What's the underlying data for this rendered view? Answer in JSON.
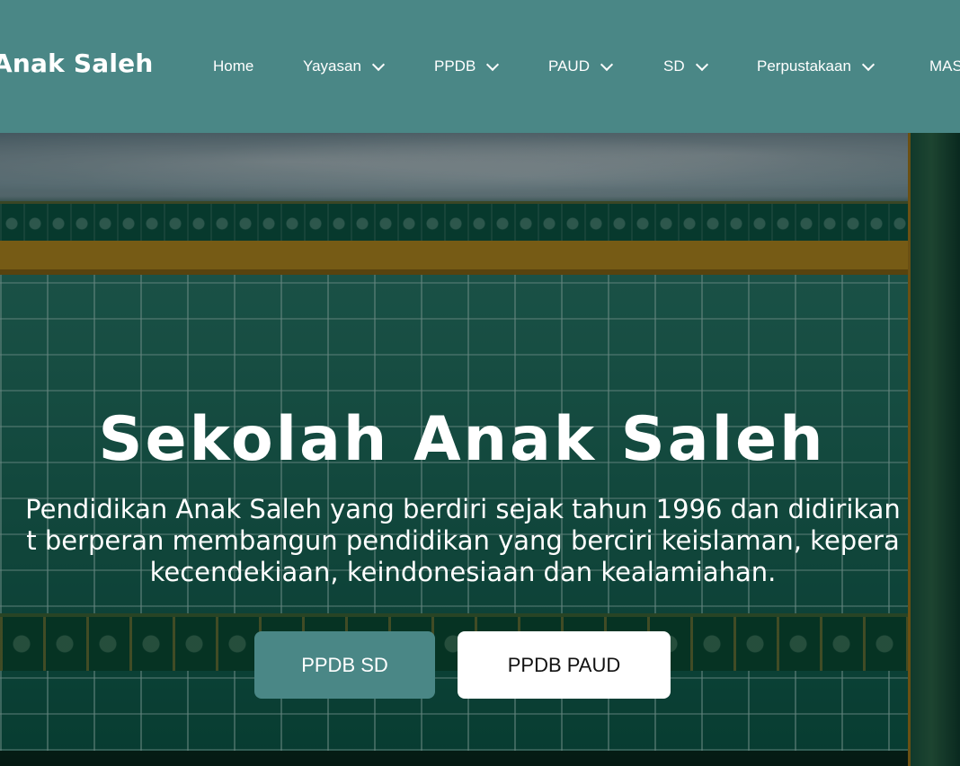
{
  "header": {
    "brand": "Anak Saleh",
    "nav": [
      {
        "label": "Home",
        "has_dropdown": false
      },
      {
        "label": "Yayasan",
        "has_dropdown": true
      },
      {
        "label": "PPDB",
        "has_dropdown": true
      },
      {
        "label": "PAUD",
        "has_dropdown": true
      },
      {
        "label": "SD",
        "has_dropdown": true
      },
      {
        "label": "Perpustakaan",
        "has_dropdown": true
      },
      {
        "label": "MAS",
        "has_dropdown": false
      }
    ]
  },
  "hero": {
    "title": "Sekolah Anak Saleh",
    "description_lines": [
      "Pendidikan Anak Saleh yang berdiri sejak tahun 1996 dan didirikan",
      "t berperan membangun pendidikan yang berciri keislaman, kepera",
      "kecendekiaan, keindonesiaan dan kealamiahan."
    ],
    "buttons": [
      {
        "label": "PPDB SD"
      },
      {
        "label": "PPDB PAUD"
      }
    ]
  },
  "colors": {
    "header_bg": "#4a8786",
    "primary_button": "#4a8786",
    "secondary_button": "#ffffff",
    "text_light": "#ffffff"
  },
  "icons": {
    "dropdown": "chevron-down-icon"
  }
}
